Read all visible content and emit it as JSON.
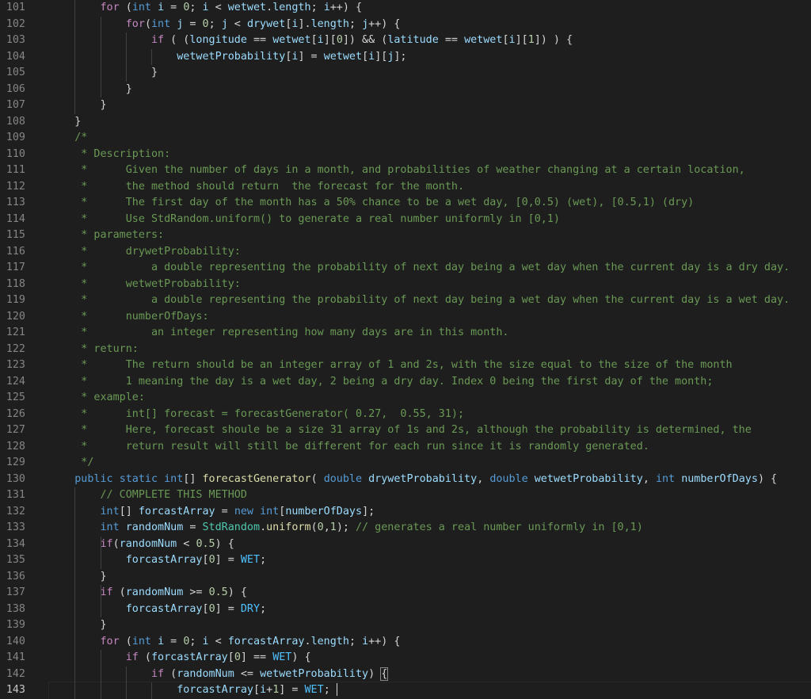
{
  "editor": {
    "current_line": 143,
    "line_numbers": [
      "101",
      "102",
      "103",
      "104",
      "105",
      "106",
      "107",
      "108",
      "109",
      "110",
      "111",
      "112",
      "113",
      "114",
      "115",
      "116",
      "117",
      "118",
      "119",
      "120",
      "121",
      "122",
      "123",
      "124",
      "125",
      "126",
      "127",
      "128",
      "129",
      "130",
      "131",
      "132",
      "133",
      "134",
      "135",
      "136",
      "137",
      "138",
      "139",
      "140",
      "141",
      "142",
      "143"
    ],
    "comment_lines": [
      "/*",
      " * Description:",
      " *      Given the number of days in a month, and probabilities of weather changing at a certain location,",
      " *      the method should return  the forecast for the month.",
      " *      The first day of the month has a 50% chance to be a wet day, [0,0.5) (wet), [0.5,1) (dry)",
      " *      Use StdRandom.uniform() to generate a real number uniformly in [0,1)",
      " * parameters:",
      " *      drywetProbability:",
      " *          a double representing the probability of next day being a wet day when the current day is a dry day.",
      " *      wetwetProbability:",
      " *          a double representing the probability of next day being a wet day when the current day is a wet day.",
      " *      numberOfDays:",
      " *          an integer representing how many days are in this month.",
      " * return:",
      " *      The return should be an integer array of 1 and 2s, with the size equal to the size of the month",
      " *      1 meaning the day is a wet day, 2 being a dry day. Index 0 being the first day of the month;",
      " * example:",
      " *      int[] forecast = forecastGenerator( 0.27,  0.55, 31);",
      " *      Here, forecast shoule be a size 31 array of 1s and 2s, although the probability is determined, the",
      " *      return result will still be different for each run since it is randomly generated.",
      " */"
    ],
    "code_text": {
      "l101": "        for (int i = 0; i < wetwet.length; i++) {",
      "l102": "            for(int j = 0; j < drywet[i].length; j++) {",
      "l103": "                if ( (longitude == wetwet[i][0]) && (latitude == wetwet[i][1]) ) {",
      "l104": "                    wetwetProbability[i] = wetwet[i][j];",
      "l105": "                }",
      "l106": "            }",
      "l107": "        }",
      "l108": "    }",
      "l130": "    public static int[] forecastGenerator( double drywetProbability, double wetwetProbability, int numberOfDays) {",
      "l131": "        // COMPLETE THIS METHOD",
      "l132": "        int[] forcastArray = new int[numberOfDays];",
      "l133": "        int randomNum = StdRandom.uniform(0,1); // generates a real number uniformly in [0,1)",
      "l134": "        if(randomNum < 0.5) {",
      "l135": "            forcastArray[0] = WET;",
      "l136": "        }",
      "l137": "        if (randomNum >= 0.5) {",
      "l138": "            forcastArray[0] = DRY;",
      "l139": "        }",
      "l140": "        for (int i = 0; i < forcastArray.length; i++) {",
      "l141": "            if (forcastArray[0] == WET) {",
      "l142": "                if (randomNum <= wetwetProbability) {",
      "l143": "                    forcastArray[i+1] = WET; "
    },
    "colors": {
      "background": "#1e1e1e",
      "keyword": "#569cd6",
      "control": "#c586c0",
      "type": "#4ec9b0",
      "function": "#dcdcaa",
      "variable": "#9cdcfe",
      "number": "#b5cea8",
      "comment": "#6a9955",
      "constant": "#4fc1ff",
      "line_number": "#858585"
    }
  }
}
